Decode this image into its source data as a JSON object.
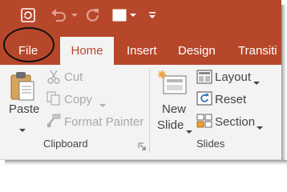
{
  "quick_access": {
    "autosave_icon": "refresh-icon",
    "undo_icon": "undo-icon",
    "redo_icon": "repeat-icon",
    "new_slide_icon": "blank-slide-icon",
    "customize_icon": "customize-arrow-icon"
  },
  "tabs": [
    {
      "label": "File"
    },
    {
      "label": "Home",
      "selected": true
    },
    {
      "label": "Insert"
    },
    {
      "label": "Design"
    },
    {
      "label": "Transiti"
    }
  ],
  "clipboard": {
    "paste_label": "Paste",
    "cut_label": "Cut",
    "copy_label": "Copy",
    "format_painter_label": "Format Painter",
    "group_label": "Clipboard"
  },
  "slides": {
    "new_slide_line1": "New",
    "new_slide_line2": "Slide",
    "layout_label": "Layout",
    "reset_label": "Reset",
    "section_label": "Section",
    "group_label": "Slides"
  },
  "colors": {
    "accent": "#b7472a",
    "ribbon_bg": "#f3f3f3",
    "disabled_text": "#a8a8a8"
  }
}
